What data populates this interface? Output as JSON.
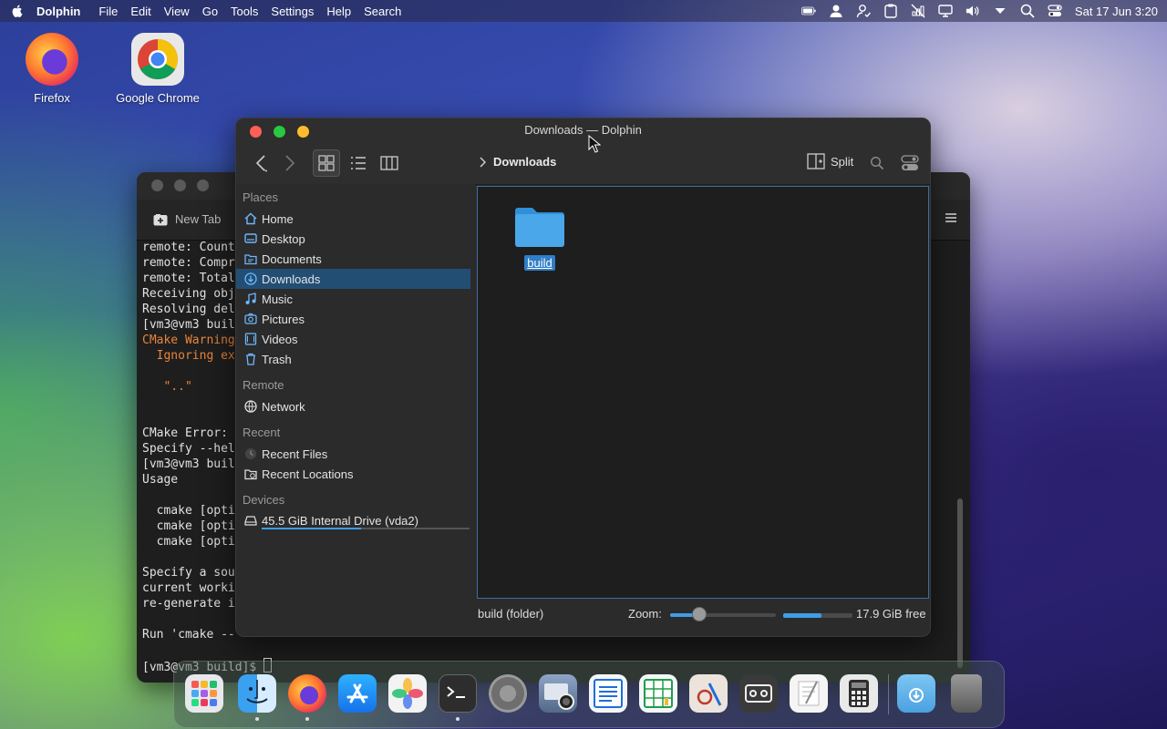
{
  "menubar": {
    "app_name": "Dolphin",
    "menus": [
      "File",
      "Edit",
      "View",
      "Go",
      "Tools",
      "Settings",
      "Help",
      "Search"
    ],
    "clock": "Sat 17 Jun 3:20"
  },
  "desktop": {
    "icons": [
      {
        "label": "Firefox"
      },
      {
        "label": "Google Chrome"
      }
    ]
  },
  "terminal": {
    "tab_label": "New Tab",
    "lines": [
      {
        "text": "remote: Count",
        "warn": false
      },
      {
        "text": "remote: Compr",
        "warn": false
      },
      {
        "text": "remote: Total",
        "warn": false
      },
      {
        "text": "Receiving obj",
        "warn": false
      },
      {
        "text": "Resolving del",
        "warn": false
      },
      {
        "text": "[vm3@vm3 buil",
        "warn": false
      },
      {
        "text": "CMake Warning",
        "warn": true
      },
      {
        "text": "  Ignoring ex",
        "warn": true
      },
      {
        "text": "",
        "warn": false
      },
      {
        "text": "   \"..\"",
        "warn": true
      },
      {
        "text": "",
        "warn": false
      },
      {
        "text": "",
        "warn": false
      },
      {
        "text": "CMake Error: ",
        "warn": false
      },
      {
        "text": "Specify --hel",
        "warn": false
      },
      {
        "text": "[vm3@vm3 buil",
        "warn": false
      },
      {
        "text": "Usage",
        "warn": false
      },
      {
        "text": "",
        "warn": false
      },
      {
        "text": "  cmake [opti",
        "warn": false
      },
      {
        "text": "  cmake [opti",
        "warn": false
      },
      {
        "text": "  cmake [opti",
        "warn": false
      },
      {
        "text": "",
        "warn": false
      },
      {
        "text": "Specify a sou",
        "warn": false
      },
      {
        "text": "current worki",
        "warn": false
      },
      {
        "text": "re-generate i",
        "warn": false
      },
      {
        "text": "",
        "warn": false
      },
      {
        "text": "Run 'cmake --",
        "warn": false
      },
      {
        "text": "",
        "warn": false
      },
      {
        "text": "[vm3@vm3 build]$ ",
        "warn": false
      }
    ]
  },
  "dolphin": {
    "title": "Downloads — Dolphin",
    "breadcrumb": "Downloads",
    "split_label": "Split",
    "sections": {
      "places": "Places",
      "remote": "Remote",
      "recent": "Recent",
      "devices": "Devices"
    },
    "places": [
      {
        "label": "Home",
        "icon": "home-icon"
      },
      {
        "label": "Desktop",
        "icon": "desktop-icon"
      },
      {
        "label": "Documents",
        "icon": "documents-icon"
      },
      {
        "label": "Downloads",
        "icon": "downloads-icon",
        "selected": true
      },
      {
        "label": "Music",
        "icon": "music-icon"
      },
      {
        "label": "Pictures",
        "icon": "pictures-icon"
      },
      {
        "label": "Videos",
        "icon": "videos-icon"
      },
      {
        "label": "Trash",
        "icon": "trash-icon"
      }
    ],
    "remote": [
      {
        "label": "Network",
        "icon": "network-icon"
      }
    ],
    "recent": [
      {
        "label": "Recent Files",
        "icon": "recent-files-icon"
      },
      {
        "label": "Recent Locations",
        "icon": "recent-locations-icon"
      }
    ],
    "devices": [
      {
        "label": "45.5 GiB Internal Drive (vda2)",
        "icon": "drive-icon",
        "usage_fraction": 0.48
      }
    ],
    "files": [
      {
        "name": "build",
        "type": "folder",
        "selected": true
      }
    ],
    "status": {
      "selection": "build (folder)",
      "zoom_label": "Zoom:",
      "zoom_fraction": 0.28,
      "free_space": "17.9 GiB free",
      "used_fraction": 0.55
    }
  },
  "colors": {
    "accent": "#3d9ee6",
    "selection": "#234e74",
    "folder": "#4aa8ea",
    "close": "#ff5f57",
    "minimize": "#febc2e",
    "maximize": "#28c840"
  }
}
